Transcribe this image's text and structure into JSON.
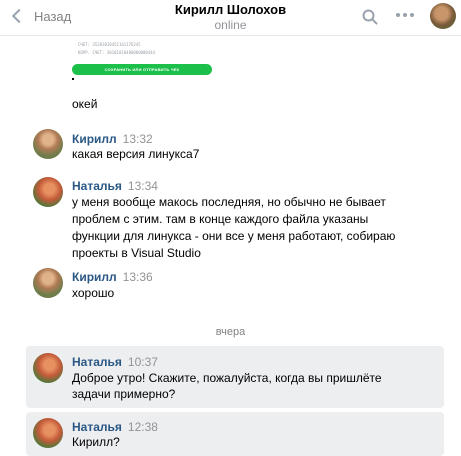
{
  "header": {
    "back_label": "Назад",
    "title": "Кирилл Шолохов",
    "status": "online"
  },
  "attachment": {
    "line1": "СЧЕТ: 35203810451161176245",
    "line2": "КОРР. СЧЕТ: 30101810400000000444",
    "button_label": "СОХРАНИТЬ ИЛИ ОТПРАВИТЬ ЧЕК"
  },
  "messages": [
    {
      "name": "",
      "time": "",
      "text": "окей"
    },
    {
      "name": "Кирилл",
      "time": "13:32",
      "text": "какая версия линукса7"
    },
    {
      "name": "Наталья",
      "time": "13:34",
      "lines": [
        "у меня вообще макось последняя, но обычно не бывает",
        "проблем с этим. там в конце каждого файла указаны",
        "функции для линукса - они все у меня работают, собираю",
        "проекты в Visual Studio"
      ]
    },
    {
      "name": "Кирилл",
      "time": "13:36",
      "text": "хорошо"
    },
    {
      "name": "Наталья",
      "time": "10:37",
      "lines": [
        "Доброе утро! Скажите, пожалуйста, когда вы пришлёте",
        "задачи примерно?"
      ]
    },
    {
      "name": "Наталья",
      "time": "12:38",
      "text": "Кирилл?"
    }
  ],
  "day_separator": "вчера",
  "colors": {
    "name_link": "#2a5885",
    "highlight_bg": "#edeef0",
    "save_button": "#1cbf4a"
  },
  "icons": [
    "chevron-left-icon",
    "search-icon",
    "more-dots-icon"
  ]
}
